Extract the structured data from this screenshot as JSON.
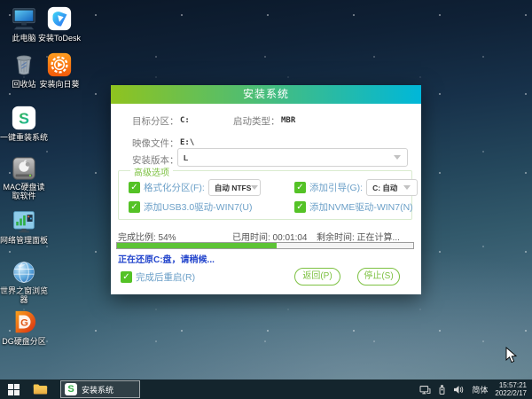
{
  "colors": {
    "title-left": "#8fc31f",
    "title-right": "#00b7d9",
    "accent-green": "#54c226",
    "button-green": "#7dc142",
    "progress-green": "#5dc336",
    "status-blue": "#2244cc",
    "label-blue": "#6ca0c8"
  },
  "desktop": {
    "icons": [
      {
        "label": "此电脑"
      },
      {
        "label": "安装ToDesk"
      },
      {
        "label": "回收站"
      },
      {
        "label": "安装向日葵"
      },
      {
        "label": "一键重装系统"
      },
      {
        "label": "MAC硬盘读取软件"
      },
      {
        "label": "网络管理面板"
      },
      {
        "label": "世界之窗浏览器"
      },
      {
        "label": "DG硬盘分区"
      }
    ]
  },
  "dialog": {
    "title": "安装系统",
    "fields": {
      "target_partition_label": "目标分区：",
      "target_partition_value": "C:",
      "boot_type_label": "启动类型：",
      "boot_type_value": "MBR",
      "image_file_label": "映像文件：",
      "image_file_value": "E:\\",
      "install_version_label": "安装版本：",
      "install_version_value": "L"
    },
    "advanced": {
      "legend": "高级选项",
      "format_label": "格式化分区(F):",
      "format_value": "自动 NTFS",
      "boot_add_label": "添加引导(G):",
      "boot_add_value": "C: 自动",
      "usb3_label": "添加USB3.0驱动-WIN7(U)",
      "nvme_label": "添加NVME驱动-WIN7(N)"
    },
    "progress": {
      "percent": 54,
      "percent_text": "完成比例: 54%",
      "elapsed_text": "已用时间: 00:01:04",
      "remaining_text": "剩余时间: 正在计算...",
      "status_text": "正在还原C:盘，请稍候...",
      "reboot_label": "完成后重启(R)"
    },
    "buttons": {
      "back": "返回(P)",
      "stop": "停止(S)"
    }
  },
  "taskbar": {
    "task_label": "安装系统",
    "language": "简体",
    "time": "15:57:21",
    "date": "2022/2/17"
  }
}
